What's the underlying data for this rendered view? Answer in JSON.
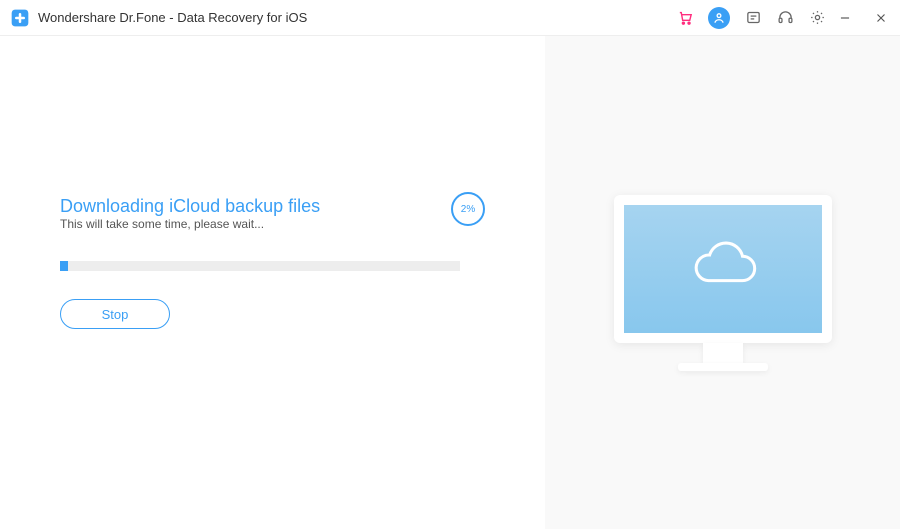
{
  "titlebar": {
    "app_title": "Wondershare Dr.Fone - Data Recovery for iOS"
  },
  "main": {
    "heading": "Downloading iCloud backup files",
    "subtext": "This will take some time, please wait...",
    "percent_label": "2%",
    "progress_percent": 2,
    "stop_label": "Stop"
  },
  "colors": {
    "accent": "#3a9ff5",
    "cart": "#ff2e7e"
  }
}
